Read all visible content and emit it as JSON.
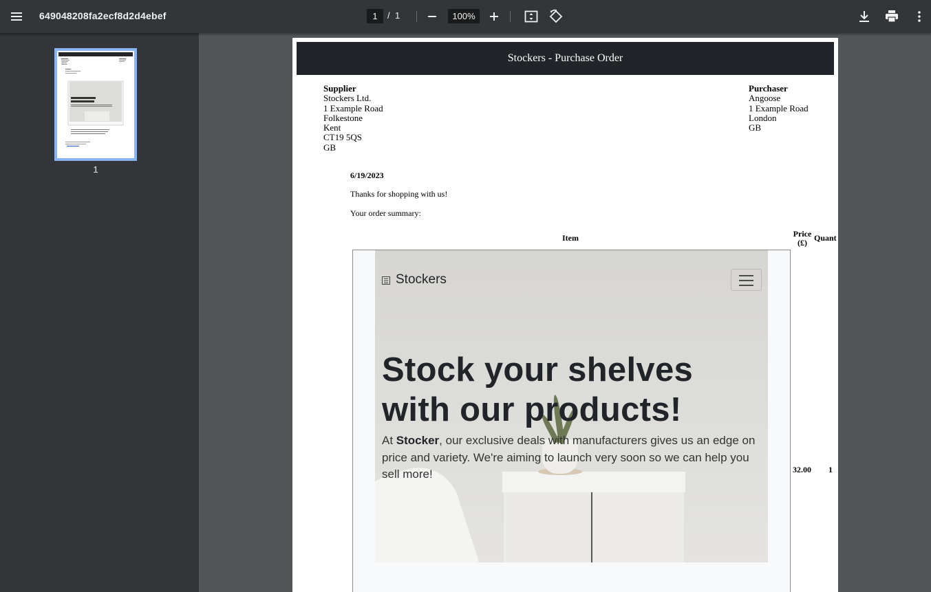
{
  "toolbar": {
    "file_name": "649048208fa2ecf8d2d4ebef",
    "current_page": "1",
    "page_separator": "/",
    "total_pages": "1",
    "zoom": "100%"
  },
  "sidebar": {
    "thumbnail_page_number": "1"
  },
  "document": {
    "header": "Stockers - Purchase Order",
    "supplier": {
      "heading": "Supplier",
      "lines": [
        "Stockers Ltd.",
        "1 Example Road",
        "Folkestone",
        "Kent",
        "CT19 5QS",
        "GB"
      ]
    },
    "purchaser": {
      "heading": "Purchaser",
      "lines": [
        "Angoose",
        "1 Example Road",
        "London",
        "GB"
      ]
    },
    "date": "6/19/2023",
    "thanks": "Thanks for shopping with us!",
    "summary": "Your order summary:",
    "table": {
      "headers": {
        "item": "Item",
        "price_line1": "Price",
        "price_line2": "(£)",
        "quantity": "Quant"
      },
      "rows": [
        {
          "price": "32.00",
          "quantity": "1"
        }
      ]
    },
    "item_image": {
      "brand": "Stockers",
      "title_line1": "Stock your shelves",
      "title_line2": "with our products!",
      "lead_prefix": "At ",
      "lead_bold": "Stocker",
      "lead_rest": ", our exclusive deals with manufacturers gives us an edge on price and variety. We're aiming to launch very soon so we can help you sell more!"
    }
  },
  "colors": {
    "toolbar_bg": "#323639",
    "viewer_bg": "#525659",
    "thumbnail_border": "#8ab4f8",
    "po_header_bg": "#212529"
  }
}
